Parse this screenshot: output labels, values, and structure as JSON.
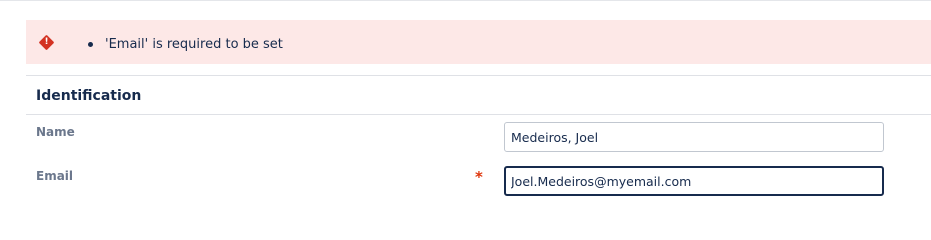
{
  "alert": {
    "icon": "error-diamond-icon",
    "color": "#d33222",
    "background": "#fde8e7",
    "messages": [
      "'Email' is required to be set"
    ]
  },
  "section": {
    "title": "Identification"
  },
  "fields": {
    "name": {
      "label": "Name",
      "value": "Medeiros, Joel",
      "required": false
    },
    "email": {
      "label": "Email",
      "value": "Joel.Medeiros@myemail.com",
      "required": true,
      "required_marker": "*",
      "focused": true
    }
  }
}
